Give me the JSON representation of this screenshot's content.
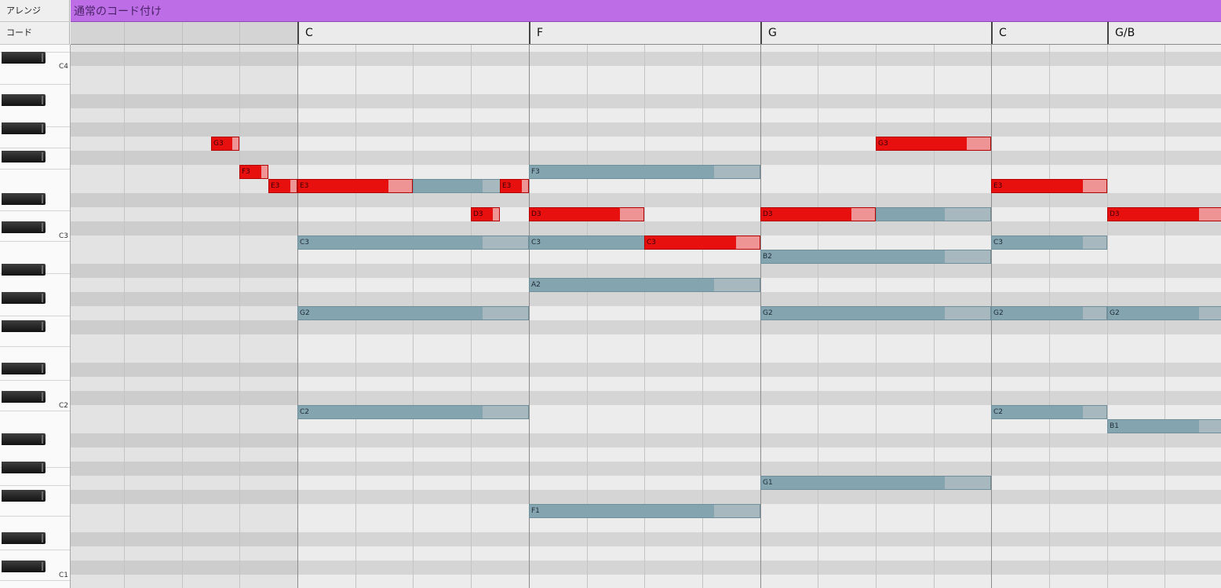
{
  "window": {
    "title": ""
  },
  "header": {
    "arrange_label": "アレンジ",
    "chord_label": "コード",
    "arrange_name": "通常のコード付け"
  },
  "chords": [
    "C",
    "F",
    "G",
    "C",
    "G/B"
  ],
  "keyboard": {
    "octave_labels": [
      "C4",
      "C3",
      "C2",
      "C1"
    ]
  },
  "notes": {
    "melody": [
      "G3",
      "F3",
      "E3",
      "E3",
      "E3",
      "D3",
      "D3",
      "C3",
      "G3",
      "D3",
      "E3",
      "D3"
    ],
    "accompaniment": [
      "C3",
      "G2",
      "C2",
      "F3",
      "C3",
      "A2",
      "F1",
      "B2",
      "G2",
      "G1",
      "C3",
      "G2",
      "C2",
      "G2",
      "B1"
    ]
  },
  "colors": {
    "arrange_track": "#bd6de6",
    "melody_note": "#e80f0f",
    "accompaniment_note": "#84a4b0"
  }
}
